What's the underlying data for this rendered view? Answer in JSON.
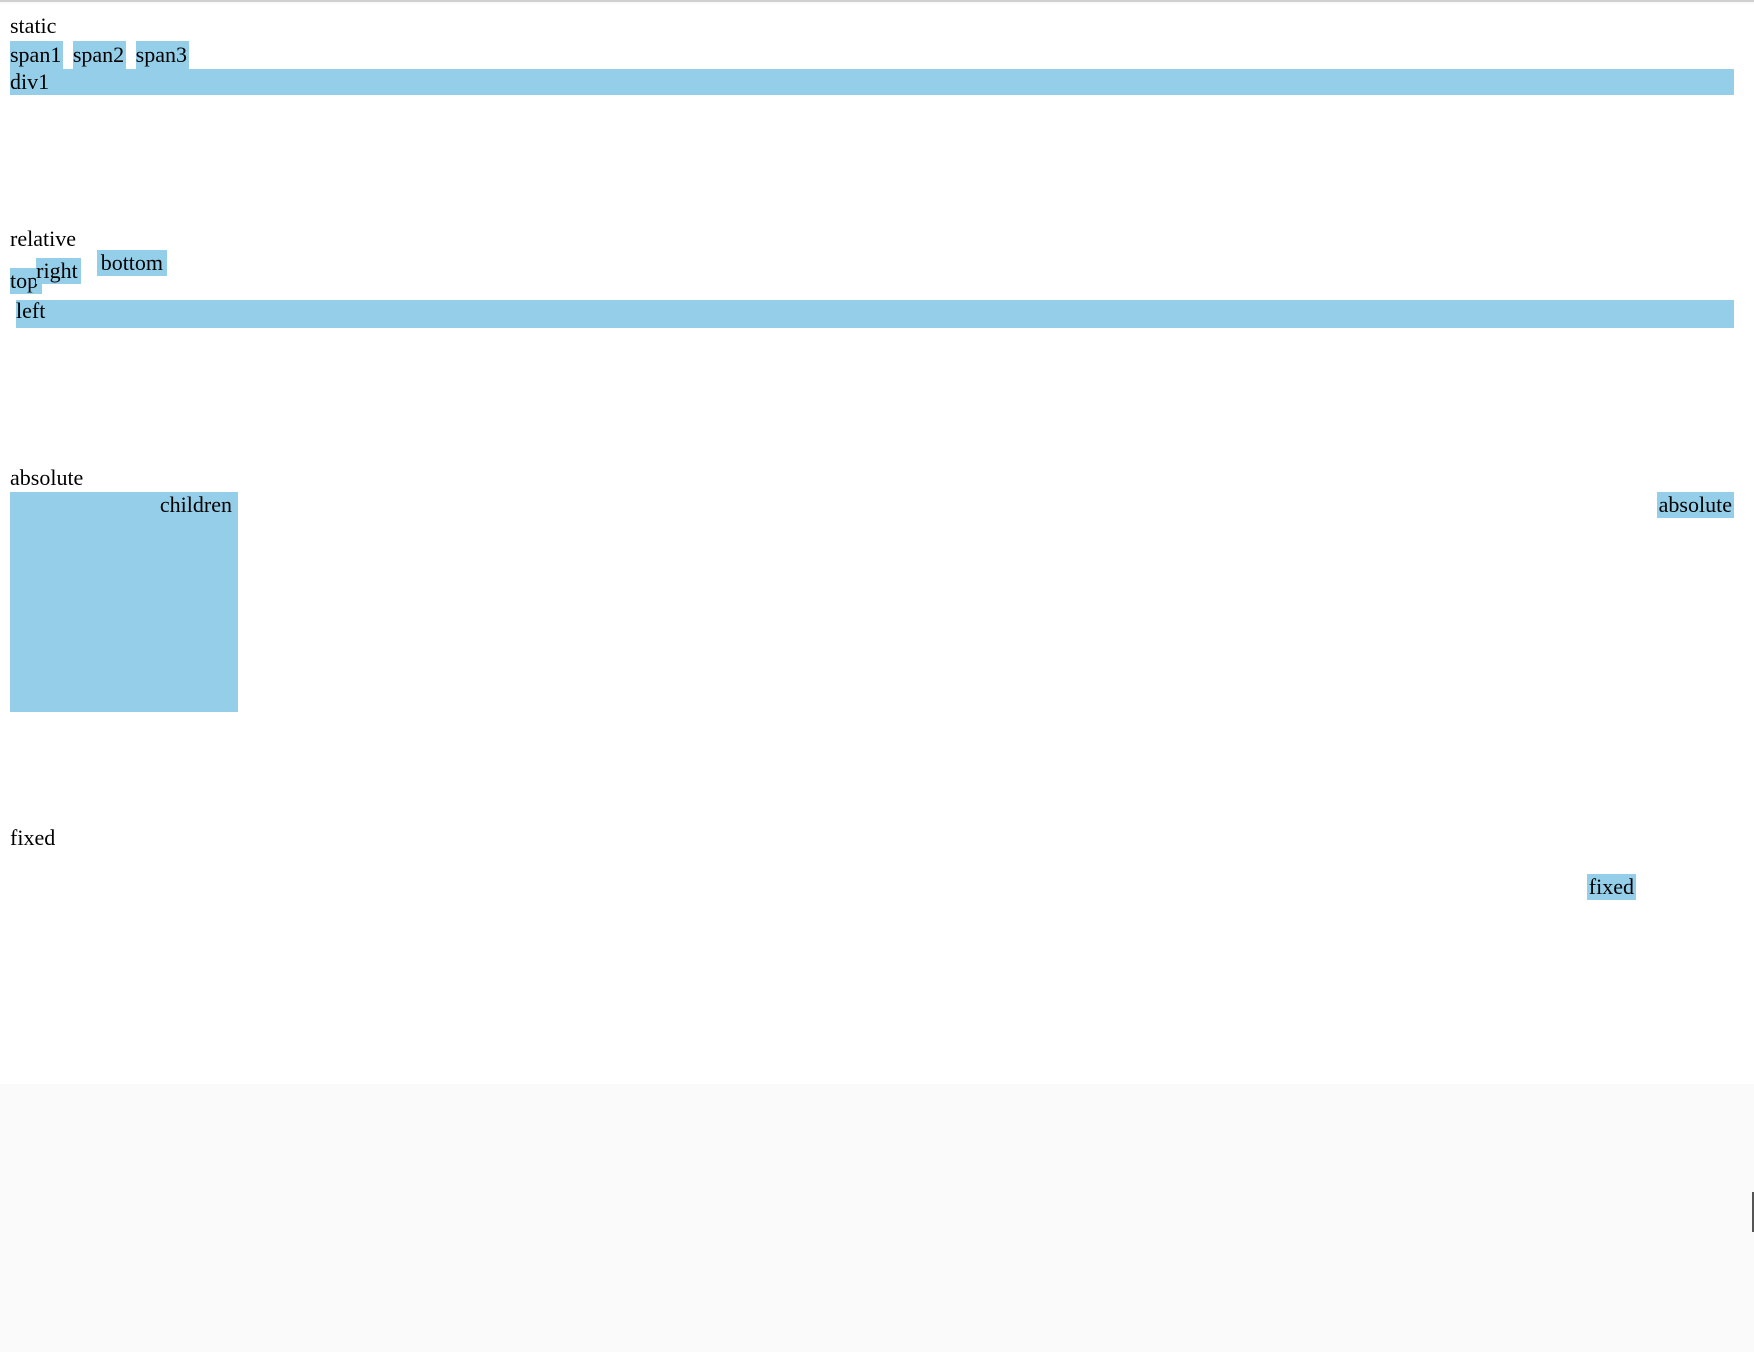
{
  "colors": {
    "accent": "#94cee8"
  },
  "sections": {
    "static": {
      "title": "static",
      "spans": [
        "span1",
        "span2",
        "span3"
      ],
      "div": "div1"
    },
    "relative": {
      "title": "relative",
      "top": "top",
      "right": "right",
      "bottom": "bottom",
      "left": "left"
    },
    "absolute": {
      "title": "absolute",
      "children_label": "children",
      "side_label": "absolute"
    },
    "fixed": {
      "title": "fixed",
      "box_label": "fixed"
    }
  }
}
